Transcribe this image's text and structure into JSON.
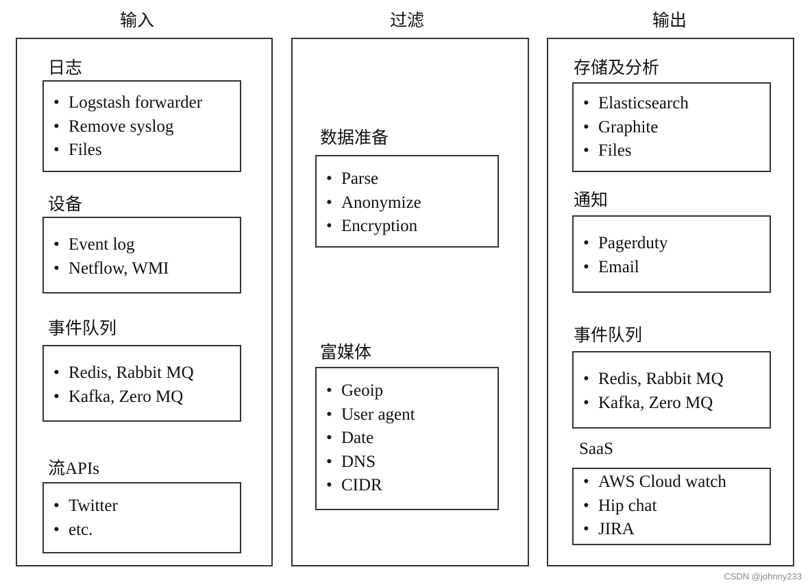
{
  "columns": [
    {
      "title": "输入",
      "sections": [
        {
          "title": "日志",
          "items": [
            "Logstash forwarder",
            "Remove syslog",
            "Files"
          ]
        },
        {
          "title": "设备",
          "items": [
            "Event log",
            "Netflow, WMI"
          ]
        },
        {
          "title": "事件队列",
          "items": [
            "Redis, Rabbit MQ",
            "Kafka, Zero MQ"
          ]
        },
        {
          "title": "流APIs",
          "items": [
            "Twitter",
            "etc."
          ]
        }
      ]
    },
    {
      "title": "过滤",
      "sections": [
        {
          "title": "数据准备",
          "items": [
            "Parse",
            "Anonymize",
            "Encryption"
          ]
        },
        {
          "title": "富媒体",
          "items": [
            "Geoip",
            "User agent",
            "Date",
            "DNS",
            "CIDR"
          ]
        }
      ]
    },
    {
      "title": "输出",
      "sections": [
        {
          "title": "存储及分析",
          "items": [
            "Elasticsearch",
            "Graphite",
            "Files"
          ]
        },
        {
          "title": "通知",
          "items": [
            "Pagerduty",
            "Email"
          ]
        },
        {
          "title": "事件队列",
          "items": [
            "Redis, Rabbit MQ",
            "Kafka, Zero MQ"
          ]
        },
        {
          "title": "SaaS",
          "items": [
            "AWS Cloud watch",
            "Hip chat",
            "JIRA"
          ]
        }
      ]
    }
  ],
  "bullet": "•",
  "watermark": "CSDN @johnny233"
}
